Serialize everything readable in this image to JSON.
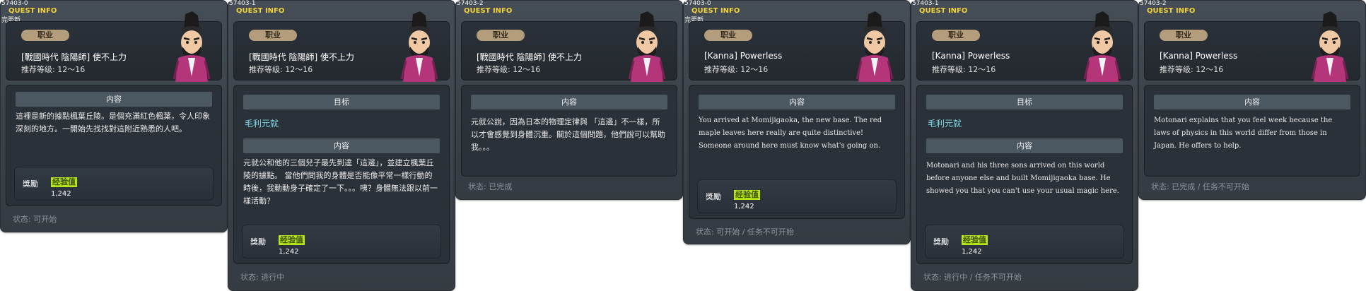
{
  "colors": {
    "panel_bg": "#3d444b",
    "quest_info": "#f3d33a",
    "job_badge": "#b49d7c",
    "target_text": "#7ddbe9",
    "exp_badge": "#b9e61b",
    "status_text": "#8a949c"
  },
  "panels": [
    {
      "id": "57403-0",
      "title": "QUEST INFO",
      "tag": "完更新",
      "job_label": "职业",
      "quest_name": "[戰國時代 陰陽師] 使不上力",
      "level": "推荐等级: 12～16",
      "content_label": "内容",
      "content_text": "這裡是新的據點楓葉丘陵。是個充滿紅色楓葉，令人印象深刻的地方。一開始先找找對這附近熟悉的人吧。",
      "reward_label": "獎勵",
      "exp_label": "经验值",
      "exp_value": "1,242",
      "status": "状态: 可开始"
    },
    {
      "id": "57403-1",
      "title": "QUEST INFO",
      "job_label": "职业",
      "quest_name": "[戰國時代 陰陽師] 使不上力",
      "level": "推荐等级: 12～16",
      "target_label": "目标",
      "target_name": "毛利元就",
      "content_label": "内容",
      "content_text": "元就公和他的三個兒子最先到達「這邊」，並建立楓葉丘陵的據點。 當他們問我的身體是否能像平常一樣行動的時後，我動動身子確定了一下。。。咦？身體無法跟以前一樣活動？",
      "reward_label": "獎勵",
      "exp_label": "经验值",
      "exp_value": "1,242",
      "status": "状态: 进行中"
    },
    {
      "id": "57403-2",
      "title": "QUEST INFO",
      "job_label": "职业",
      "quest_name": "[戰國時代 陰陽師] 使不上力",
      "level": "推荐等级: 12～16",
      "content_label": "内容",
      "content_text": "元就公說，因為日本的物理定律與 「這邊」不一樣，所以才會感覺到身體沉重。關於這個問題，他們說可以幫助我。。。",
      "status": "状态: 已完成"
    },
    {
      "id": "57403-0",
      "title": "QUEST INFO",
      "tag": "完更新",
      "job_label": "职业",
      "quest_name": "[Kanna] Powerless",
      "level": "推荐等级: 12～16",
      "content_label": "内容",
      "content_text": "You arrived at Momijigaoka, the new base. The red maple leaves here really are quite distinctive! Someone around here must know what's going on.",
      "reward_label": "獎勵",
      "exp_label": "经验值",
      "exp_value": "1,242",
      "status": "状态: 可开始 / 任务不可开始"
    },
    {
      "id": "57403-1",
      "title": "QUEST INFO",
      "job_label": "职业",
      "quest_name": "[Kanna] Powerless",
      "level": "推荐等级: 12～16",
      "target_label": "目标",
      "target_name": "毛利元就",
      "content_label": "内容",
      "content_text": "Motonari and his three sons arrived on this world before anyone else and built Momijigaoka base. He showed you that you can't use your usual magic here.",
      "reward_label": "獎勵",
      "exp_label": "经验值",
      "exp_value": "1,242",
      "status": "状态: 进行中 / 任务不可开始"
    },
    {
      "id": "57403-2",
      "title": "QUEST INFO",
      "job_label": "职业",
      "quest_name": "[Kanna] Powerless",
      "level": "推荐等级: 12～16",
      "content_label": "内容",
      "content_text": "Motonari explains that you feel week because the laws of physics in this world differ from those in Japan. He offers to help.",
      "status": "状态: 已完成 / 任务不可开始"
    }
  ]
}
